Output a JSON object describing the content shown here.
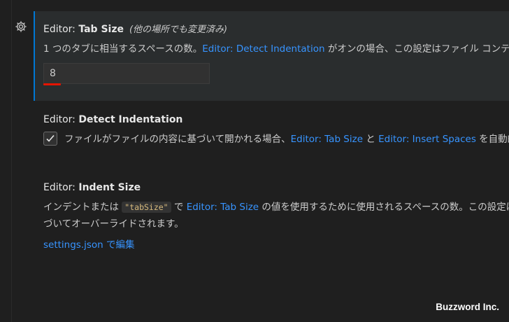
{
  "settings": {
    "tab_size": {
      "category": "Editor: ",
      "name": "Tab Size",
      "modified_note": "(他の場所でも変更済み)",
      "desc_prefix": "1 つのタブに相当するスペースの数。",
      "desc_link": "Editor: Detect Indentation",
      "desc_suffix": " がオンの場合、この設定はファイル コンテンツに",
      "value": "8"
    },
    "detect_indentation": {
      "category": "Editor: ",
      "name": "Detect Indentation",
      "checked": true,
      "desc_prefix": "ファイルがファイルの内容に基づいて開かれる場合、",
      "desc_link1": "Editor: Tab Size",
      "desc_mid": " と ",
      "desc_link2": "Editor: Insert Spaces",
      "desc_suffix": " を自動的に"
    },
    "indent_size": {
      "category": "Editor: ",
      "name": "Indent Size",
      "desc_line1_prefix": "インデントまたは ",
      "desc_code": "\"tabSize\"",
      "desc_line1_mid": " で ",
      "desc_link": "Editor: Tab Size",
      "desc_line1_suffix": " の値を使用するために使用されるスペースの数。この設定は、",
      "desc_line2": "づいてオーバーライドされます。",
      "edit_link": "settings.json で編集"
    }
  },
  "watermark": "Buzzword Inc.",
  "colors": {
    "background": "#1f1f1f",
    "focused_background": "#2a2d2e",
    "focus_border": "#0078d4",
    "link": "#3794ff",
    "error_underline": "#e51400"
  },
  "icons": {
    "gear": "gear-icon",
    "check": "check-icon"
  }
}
